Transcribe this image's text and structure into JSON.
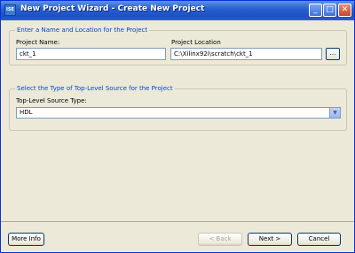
{
  "window": {
    "title": "New Project Wizard - Create New Project",
    "icon_label": "ISE"
  },
  "titlebar_buttons": {
    "minimize": "_",
    "maximize": "□",
    "close": "✕"
  },
  "location_group": {
    "legend": "Enter a Name and Location for the Project",
    "project_name_label": "Project Name:",
    "project_name_value": "ckt_1",
    "project_location_label": "Project Location",
    "project_location_value": "C:\\Xilinx92i\\scratch\\ckt_1",
    "browse_label": "..."
  },
  "source_group": {
    "legend": "Select the Type of Top-Level Source for the Project",
    "source_type_label": "Top-Level Source Type:",
    "source_type_value": "HDL"
  },
  "buttons": {
    "more_info": "More Info",
    "back": "< Back",
    "next": "Next >",
    "cancel": "Cancel"
  },
  "icons": {
    "app": "app-icon",
    "dropdown": "chevron-down-icon"
  },
  "colors": {
    "titlebar": "#2860d0",
    "legend": "#0046d5",
    "window_bg": "#ece9d8"
  }
}
